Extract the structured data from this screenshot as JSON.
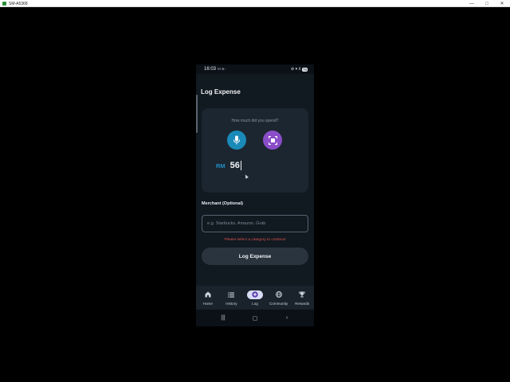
{
  "window": {
    "title": "SM-A5368",
    "minimize": "—",
    "maximize": "□",
    "close": "✕"
  },
  "status_bar": {
    "time": "16:03",
    "left_icons": "M ⊕ ·",
    "right_icons": "⊘ ▾ ıl",
    "battery": "76"
  },
  "page": {
    "title": "Log Expense"
  },
  "expense_card": {
    "question": "How much did you spend?",
    "currency": "RM",
    "amount": "56"
  },
  "merchant": {
    "label": "Merchant (Optional)",
    "placeholder": "e.g. Starbucks, Amazon, Grab",
    "value": ""
  },
  "validation": {
    "message": "Please select a category to continue"
  },
  "actions": {
    "log_label": "Log Expense"
  },
  "bottom_nav": {
    "items": [
      {
        "label": "Home",
        "icon": "home-icon"
      },
      {
        "label": "History",
        "icon": "list-icon"
      },
      {
        "label": "Log",
        "icon": "add-circle-icon",
        "active": true
      },
      {
        "label": "Community",
        "icon": "globe-icon"
      },
      {
        "label": "Rewards",
        "icon": "trophy-icon"
      }
    ]
  },
  "system_nav": {
    "recents": "|||",
    "home": "▢",
    "back": "‹"
  },
  "colors": {
    "background": "#111921",
    "card": "#1c2630",
    "mic_button": "#1a8ab8",
    "scan_button": "#8a4ec9",
    "currency": "#1f8fc7",
    "error": "#d9534f",
    "active_nav": "#d9dcf5"
  }
}
